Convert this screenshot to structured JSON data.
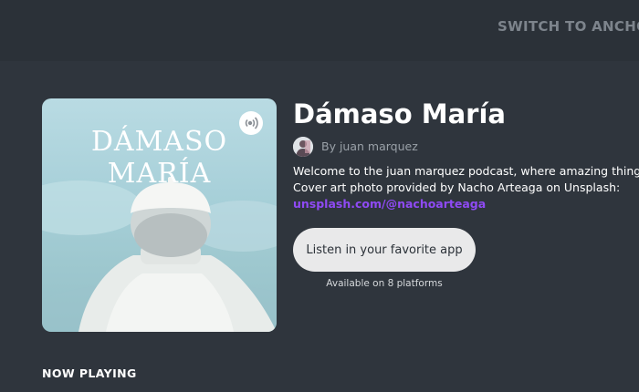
{
  "header": {
    "switch_link_label": "SWITCH TO ANCHOR"
  },
  "podcast": {
    "cover_title": "DÁMASO MARÍA",
    "cover_badge_icon": "podcast-broadcast-icon",
    "title": "Dámaso María",
    "author": "By juan marquez",
    "description_line1": "Welcome to the juan marquez podcast, where amazing things happen.",
    "description_line2": "Cover art photo provided by Nacho Arteaga on Unsplash:",
    "description_link": "unsplash.com/@nachoarteaga"
  },
  "listen": {
    "button_label": "Listen in your favorite app",
    "availability": "Available on 8 platforms"
  },
  "section": {
    "now_playing": "NOW PLAYING"
  },
  "colors": {
    "background": "#2f353d",
    "topbar": "#2b3138",
    "link": "#8f4af4",
    "button_bg": "#e9e9ea"
  }
}
